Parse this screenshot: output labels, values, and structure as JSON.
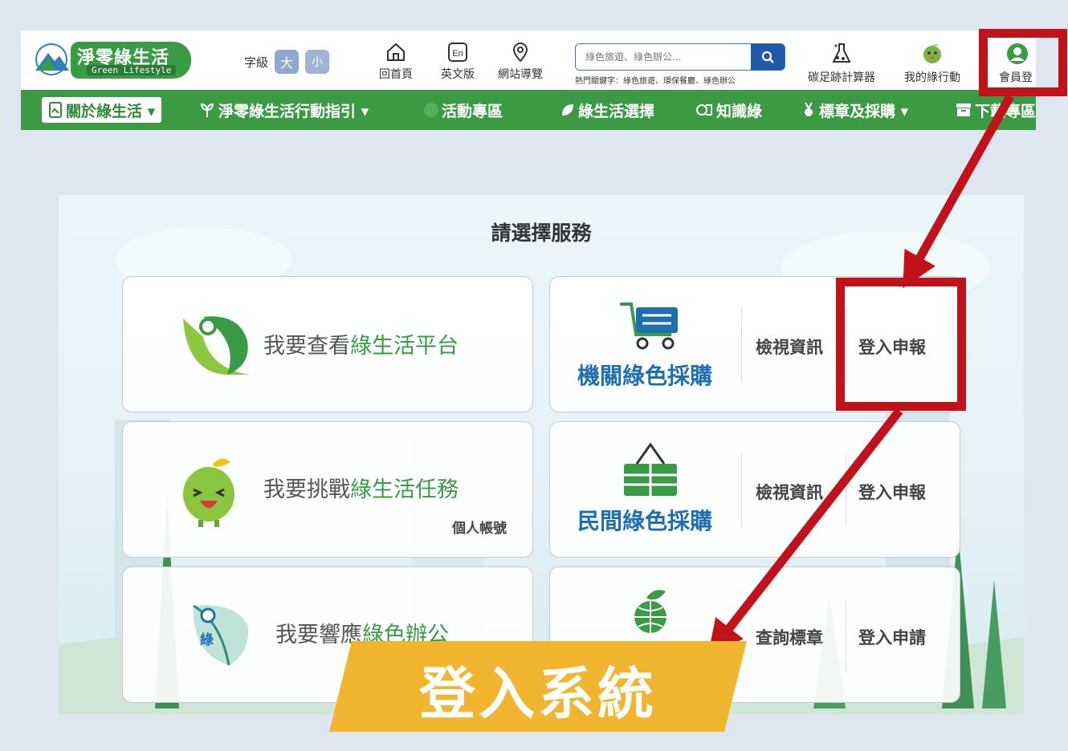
{
  "logo": {
    "main": "淨零綠生活",
    "sub": "Green Lifestyle"
  },
  "fontsize": {
    "label": "字級",
    "large": "大",
    "small": "小"
  },
  "top_links": {
    "home": "回首頁",
    "english": "英文版",
    "sitemap": "網站導覽",
    "carbon": "碳足跡計算器",
    "my_action": "我的綠行動",
    "login": "會員登入"
  },
  "search": {
    "placeholder": "綠色旅遊、綠色辦公...",
    "hot": "熱門關鍵字：綠色旅遊、環保餐廳、綠色辦公"
  },
  "nav": {
    "about": "關於綠生活 ▾",
    "guide": "淨零綠生活行動指引 ▾",
    "events": "活動專區",
    "choice": "綠生活選擇",
    "knowledge": "知識綠",
    "labels": "標章及採購 ▾",
    "download": "下載專區"
  },
  "panel": {
    "title": "請選擇服務",
    "cards": {
      "platform": {
        "prefix": "我要查看",
        "green": "綠生活平台"
      },
      "mission": {
        "prefix": "我要挑戰",
        "green": "綠生活任務",
        "sub": "個人帳號"
      },
      "office": {
        "prefix": "我要響應",
        "green": "綠色辦公",
        "icon_label": "綠色辦公"
      },
      "gov": {
        "title": "機關綠色採購",
        "view": "檢視資訊",
        "login": "登入申報"
      },
      "private": {
        "title": "民間綠色採購",
        "view": "檢視資訊",
        "login": "登入申報"
      },
      "label": {
        "view": "查詢標章",
        "login": "登入申請"
      }
    }
  },
  "annotation": {
    "banner": "登入系統",
    "color_red": "#c1121b",
    "color_banner": "#f2b530"
  }
}
